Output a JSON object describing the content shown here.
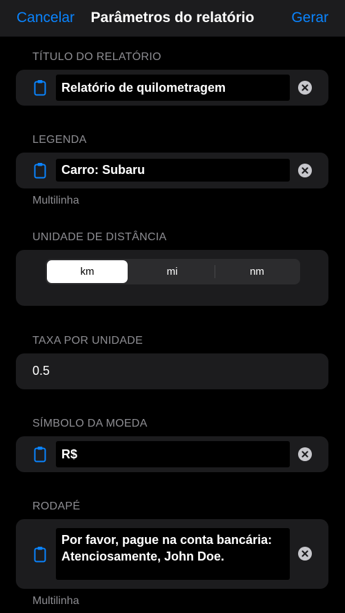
{
  "nav": {
    "cancel_label": "Cancelar",
    "title": "Parâmetros do relatório",
    "generate_label": "Gerar"
  },
  "report_title": {
    "header": "TÍTULO DO RELATÓRIO",
    "value": "Relatório de quilometragem"
  },
  "legend": {
    "header": "LEGENDA",
    "value": "Carro: Subaru",
    "footer": "Multilinha"
  },
  "distance_unit": {
    "header": "UNIDADE DE DISTÂNCIA",
    "options": [
      "km",
      "mi",
      "nm"
    ],
    "selected": "km"
  },
  "rate": {
    "header": "TAXA POR UNIDADE",
    "value": "0.5"
  },
  "currency": {
    "header": "SÍMBOLO DA MOEDA",
    "value": "R$"
  },
  "footer_section": {
    "header": "RODAPÉ",
    "line1": "Por favor, pague na conta bancária:",
    "line2": "Atenciosamente, John Doe.",
    "footer": "Multilinha"
  },
  "icons": {
    "field_icon": "clipboard-icon",
    "clear_icon": "clear-circle-icon"
  },
  "colors": {
    "accent": "#0a84ff",
    "background": "#000000",
    "card": "#1c1c1e",
    "secondary_text": "#8e8e93"
  }
}
